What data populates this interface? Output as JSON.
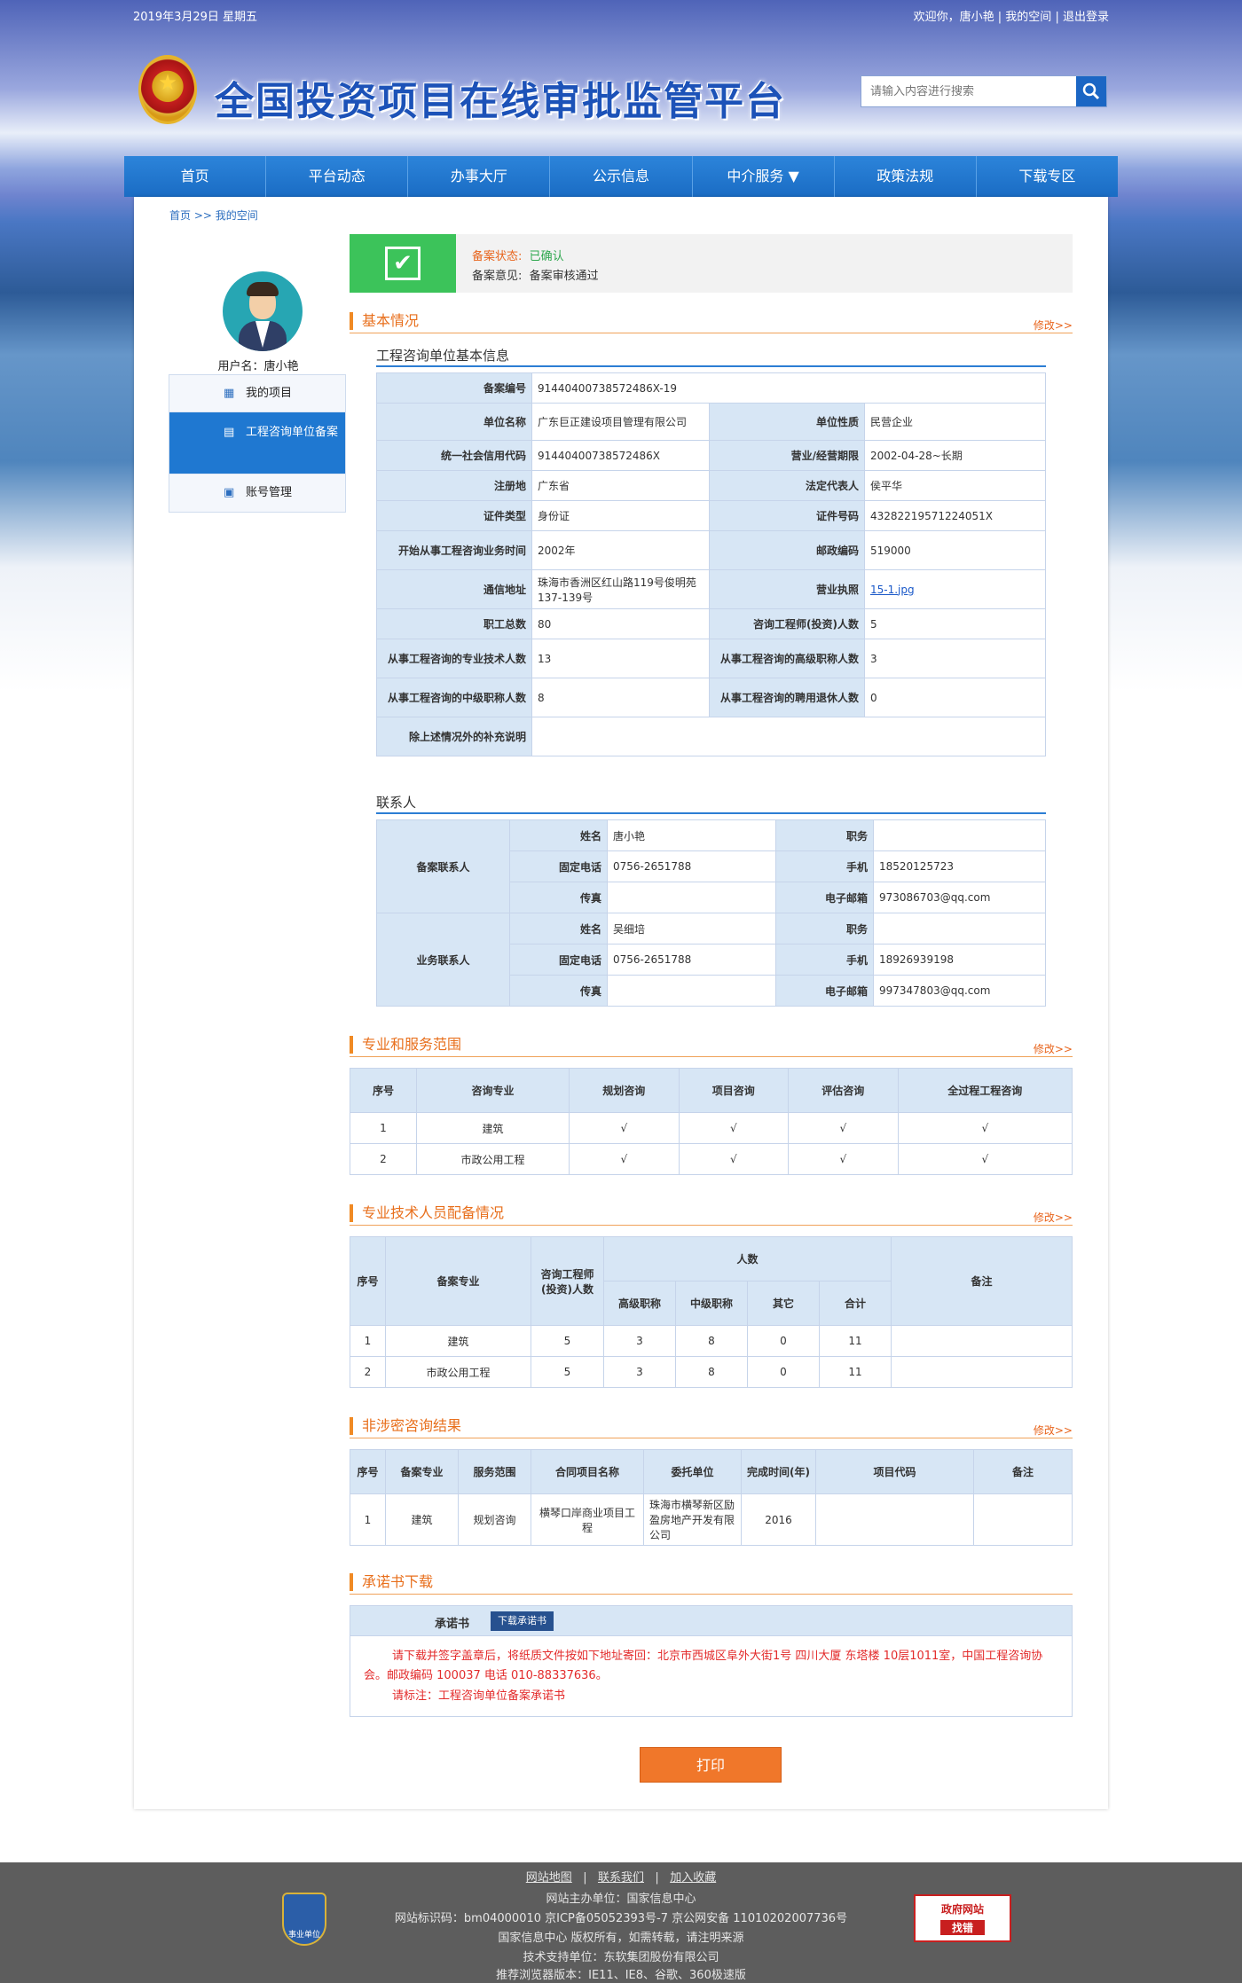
{
  "topbar": {
    "date": "2019年3月29日 星期五",
    "welcome": "欢迎你，唐小艳",
    "sep": "|",
    "my_space": "我的空间",
    "logout": "退出登录"
  },
  "site_title": "全国投资项目在线审批监管平台",
  "search": {
    "placeholder": "请输入内容进行搜索"
  },
  "nav": [
    "首页",
    "平台动态",
    "办事大厅",
    "公示信息",
    "中介服务 ▼",
    "政策法规",
    "下载专区"
  ],
  "breadcrumb": {
    "home": "首页",
    "sep": ">>",
    "current": "我的空间"
  },
  "user": {
    "name_label": "用户名：唐小艳"
  },
  "sidebar": [
    {
      "label": "我的项目",
      "icon": "grid-icon"
    },
    {
      "label": "工程咨询单位备案",
      "icon": "document-icon"
    },
    {
      "label": "账号管理",
      "icon": "account-icon"
    }
  ],
  "status": {
    "label1": "备案状态:",
    "value1": "已确认",
    "label2": "备案意见:",
    "value2": "备案审核通过"
  },
  "edit_label": "修改>>",
  "sections": {
    "basic": "基本情况",
    "scope": "专业和服务范围",
    "staff": "专业技术人员配备情况",
    "results": "非涉密咨询结果",
    "pledge": "承诺书下载"
  },
  "basic_subtitle": "工程咨询单位基本信息",
  "basic": {
    "reg_no_k": "备案编号",
    "reg_no": "91440400738572486X-19",
    "name_k": "单位名称",
    "name": "广东巨正建设项目管理有限公司",
    "nature_k": "单位性质",
    "nature": "民营企业",
    "credit_k": "统一社会信用代码",
    "credit": "91440400738572486X",
    "term_k": "营业/经营期限",
    "term": "2002-04-28~长期",
    "regplace_k": "注册地",
    "regplace": "广东省",
    "legal_k": "法定代表人",
    "legal": "侯平华",
    "certtype_k": "证件类型",
    "certtype": "身份证",
    "certno_k": "证件号码",
    "certno": "43282219571224051X",
    "start_k": "开始从事工程咨询业务时间",
    "start": "2002年",
    "zip_k": "邮政编码",
    "zip": "519000",
    "addr_k": "通信地址",
    "addr": "珠海市香洲区红山路119号俊明苑137-139号",
    "license_k": "营业执照",
    "license": "15-1.jpg",
    "staff_k": "职工总数",
    "staff": "80",
    "consult_k": "咨询工程师(投资)人数",
    "consult": "5",
    "tech_k": "从事工程咨询的专业技术人数",
    "tech": "13",
    "senior_k": "从事工程咨询的高级职称人数",
    "senior": "3",
    "mid_k": "从事工程咨询的中级职称人数",
    "mid": "8",
    "retired_k": "从事工程咨询的聘用退休人数",
    "retired": "0",
    "extra_k": "除上述情况外的补充说明",
    "extra": ""
  },
  "contact_subtitle": "联系人",
  "contacts": {
    "name_k": "姓名",
    "post_k": "职务",
    "tel_k": "固定电话",
    "mobile_k": "手机",
    "fax_k": "传真",
    "email_k": "电子邮箱",
    "filing": {
      "group": "备案联系人",
      "name": "唐小艳",
      "post": "",
      "tel": "0756-2651788",
      "mobile": "18520125723",
      "fax": "",
      "email": "973086703@qq.com"
    },
    "business": {
      "group": "业务联系人",
      "name": "吴细培",
      "post": "",
      "tel": "0756-2651788",
      "mobile": "18926939198",
      "fax": "",
      "email": "997347803@qq.com"
    }
  },
  "scope": {
    "headers": [
      "序号",
      "咨询专业",
      "规划咨询",
      "项目咨询",
      "评估咨询",
      "全过程工程咨询"
    ],
    "rows": [
      [
        "1",
        "建筑",
        "√",
        "√",
        "√",
        "√"
      ],
      [
        "2",
        "市政公用工程",
        "√",
        "√",
        "√",
        "√"
      ]
    ]
  },
  "staff": {
    "h_no": "序号",
    "h_major": "备案专业",
    "h_consult": "咨询工程师(投资)人数",
    "h_people": "人数",
    "h_remark": "备注",
    "h_sub": [
      "高级职称",
      "中级职称",
      "其它",
      "合计"
    ],
    "rows": [
      [
        "1",
        "建筑",
        "5",
        "3",
        "8",
        "0",
        "11",
        ""
      ],
      [
        "2",
        "市政公用工程",
        "5",
        "3",
        "8",
        "0",
        "11",
        ""
      ]
    ]
  },
  "results": {
    "headers": [
      "序号",
      "备案专业",
      "服务范围",
      "合同项目名称",
      "委托单位",
      "完成时间(年)",
      "项目代码",
      "备注"
    ],
    "rows": [
      [
        "1",
        "建筑",
        "规划咨询",
        "横琴口岸商业项目工程",
        "珠海市横琴新区励盈房地产开发有限公司",
        "2016",
        "",
        ""
      ]
    ]
  },
  "pledge": {
    "key": "承诺书",
    "button": "下载承诺书",
    "text": "请下载并签字盖章后，将纸质文件按如下地址寄回：北京市西城区阜外大街1号 四川大厦 东塔楼 10层1011室，中国工程咨询协会。邮政编码 100037 电话 010-88337636。",
    "note": "请标注：工程咨询单位备案承诺书"
  },
  "print_label": "打印",
  "footer": {
    "links": [
      "网站地图",
      "联系我们",
      "加入收藏"
    ],
    "sponsor": "网站主办单位：国家信息中心",
    "icp": "网站标识码：bm04000010  京ICP备05052393号-7  京公网安备 11010202007736号",
    "copyright": "国家信息中心 版权所有，如需转载，请注明来源",
    "support": "技术支持单位：东软集团股份有限公司",
    "browser": "推荐浏览器版本：IE11、IE8、谷歌、360极速版",
    "badge_label": "事业单位",
    "gov_label": "政府网站",
    "gov_btn": "找错"
  }
}
